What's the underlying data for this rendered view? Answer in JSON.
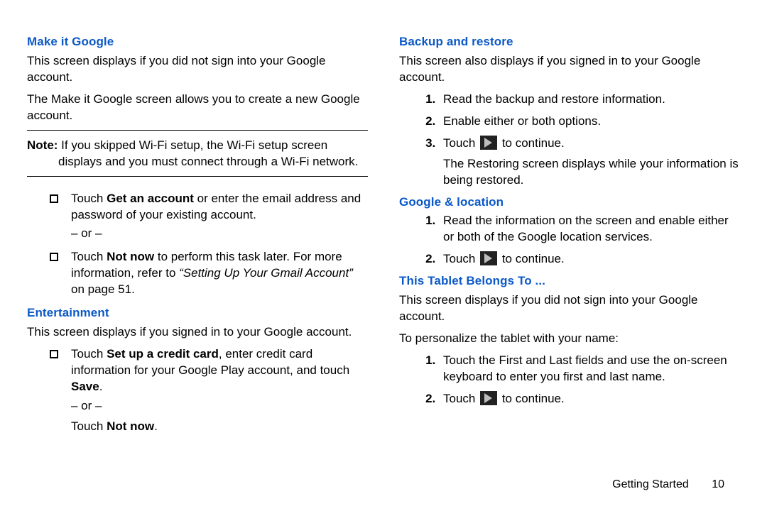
{
  "left": {
    "h_make_it_google": "Make it Google",
    "mig_p1": "This screen displays if you did not sign into your Google account.",
    "mig_p2": "The Make it Google screen allows you to create a new Google account.",
    "note_label": "Note:",
    "note_text_line1": " If you skipped Wi-Fi setup, the Wi-Fi setup screen",
    "note_text_line2": "displays and you must connect through a Wi-Fi network.",
    "bullets": {
      "b1_pre": "Touch ",
      "b1_bold": "Get an account",
      "b1_post": " or enter the email address and password of your existing account.",
      "or": "– or –",
      "b2_pre": "Touch ",
      "b2_bold": "Not now",
      "b2_mid": " to perform this task later. For more information, refer to ",
      "b2_ref": "“Setting Up Your Gmail Account”",
      "b2_post": " on page 51."
    },
    "h_entertainment": "Entertainment",
    "ent_p1": "This screen displays if you signed in to your Google account.",
    "ent_bullets": {
      "b1_pre": "Touch ",
      "b1_bold": "Set up a credit card",
      "b1_mid": ", enter credit card information for your Google Play account, and touch ",
      "b1_bold2": "Save",
      "b1_post": ".",
      "or": "– or –",
      "b2_pre": "Touch ",
      "b2_bold": "Not now",
      "b2_post": "."
    }
  },
  "right": {
    "h_backup": "Backup and restore",
    "bk_p1": "This screen also displays if you signed in to your Google account.",
    "bk_lis": {
      "i1": "Read the backup and restore information.",
      "i2": "Enable either or both options.",
      "i3_pre": "Touch ",
      "i3_post": " to continue.",
      "i3_tail": "The Restoring screen displays while your information is being restored."
    },
    "h_google_loc": "Google & location",
    "gl_lis": {
      "i1": "Read the information on the screen and enable either or both of the Google location services.",
      "i2_pre": "Touch ",
      "i2_post": " to continue."
    },
    "h_tablet": "This Tablet Belongs To ...",
    "tb_p1": "This screen displays if you did not sign into your Google account.",
    "tb_p2": "To personalize the tablet with your name:",
    "tb_lis": {
      "i1": "Touch the First and Last fields and use the on-screen keyboard to enter you first and last name.",
      "i2_pre": "Touch ",
      "i2_post": " to continue."
    }
  },
  "footer": {
    "section": "Getting Started",
    "page": "10"
  }
}
